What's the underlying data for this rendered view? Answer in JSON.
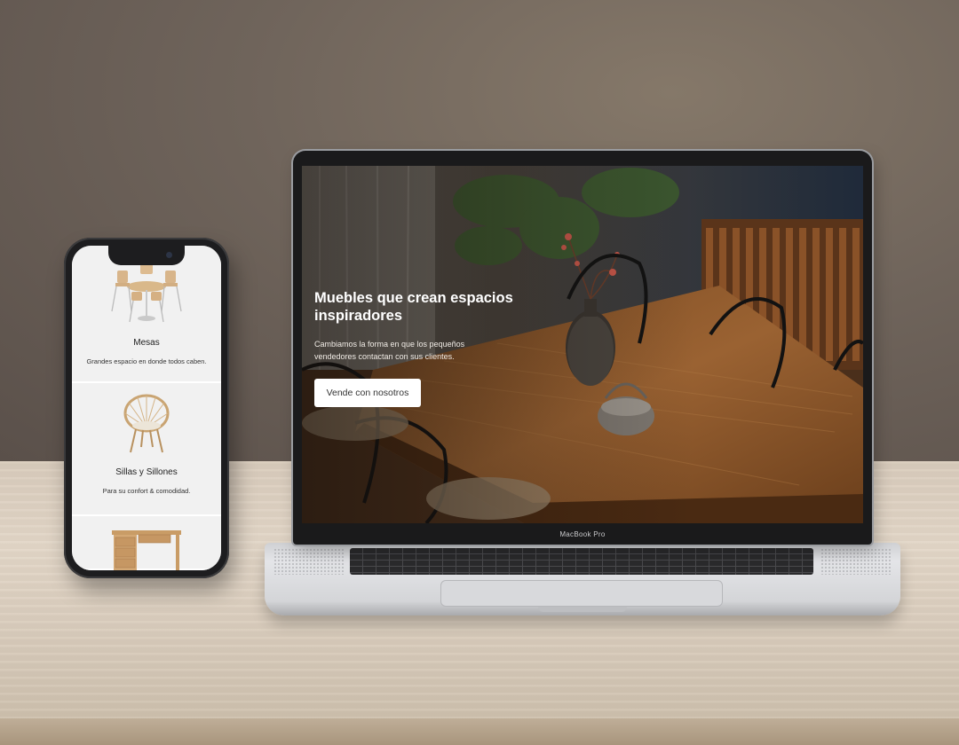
{
  "phone": {
    "categories": [
      {
        "name": "Mesas",
        "description": "Grandes espacio en donde todos caben."
      },
      {
        "name": "Sillas y Sillones",
        "description": "Para su confort & comodidad."
      },
      {
        "name": "",
        "description": ""
      }
    ]
  },
  "laptop": {
    "brand_label": "MacBook Pro",
    "hero": {
      "title": "Muebles que crean espacios inspiradores",
      "subtitle": "Cambiamos la forma en que los pequeños vendedores contactan con sus clientes.",
      "cta_label": "Vende con nosotros"
    }
  }
}
